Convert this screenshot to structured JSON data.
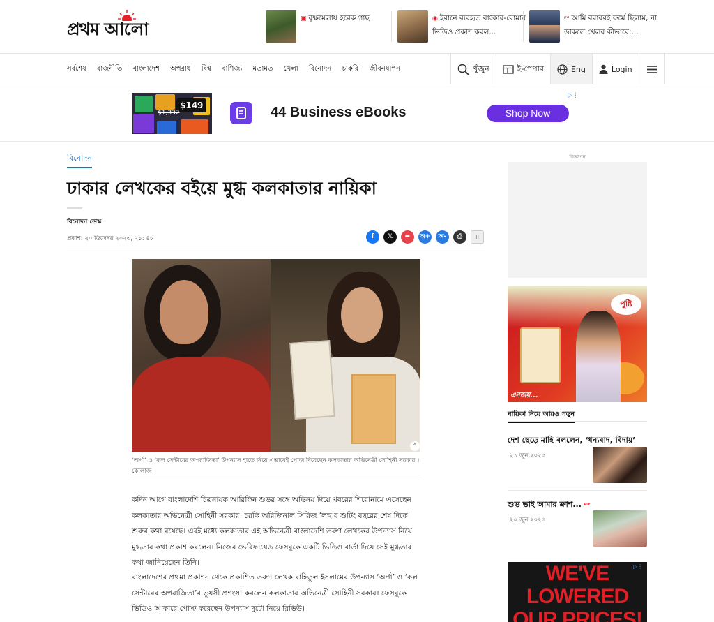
{
  "header": {
    "logo_text": "প্রথম আলো",
    "teasers": [
      {
        "title": "বৃক্ষমেলায় হরেক গাছ",
        "marker": "📷"
      },
      {
        "title": "ইরানে ব্যবহৃত বাংকার-বোমার ভিডিও প্রকাশ করল...",
        "marker": "◉"
      },
      {
        "title": "আমি বরাবরই ফর্মে ছিলাম, না ডাকলে খেলব কীভাবে:...",
        "marker": "ᵖᵃ"
      }
    ]
  },
  "nav": {
    "items": [
      "সর্বশেষ",
      "রাজনীতি",
      "বাংলাদেশ",
      "অপরাধ",
      "বিশ্ব",
      "বাণিজ্য",
      "মতামত",
      "খেলা",
      "বিনোদন",
      "চাকরি",
      "জীবনযাপন"
    ],
    "search_label": "খুঁজুন",
    "epaper_label": "ই-পেপার",
    "lang_label": "Eng",
    "login_label": "Login"
  },
  "ad_banner": {
    "price": "$149",
    "old_price": "$1,332",
    "title": "44 Business eBooks",
    "cta": "Shop Now"
  },
  "article": {
    "section": "বিনোদন",
    "headline": "ঢাকার লেখকের বইয়ে মুগ্ধ কলকাতার নায়িকা",
    "author": "বিনোদন ডেস্ক",
    "published": "প্রকাশ: ২০ ডিসেম্বর ২০২৩, ২১: ৪৮",
    "caption": "‘অর্পা’ ও ‘কল সেন্টারের অপরাজিতা’ উপন্যাস হাতে নিয়ে এভাবেই পোজ দিয়েছেন কলকাতার অভিনেত্রী সোহিনী সরকার । কোলাজ",
    "paragraphs": [
      "কদিন আগে বাংলাদেশি চিত্রনায়ক আরিফিন শুভর সঙ্গে অভিনয় দিয়ে খবরের শিরোনামে এসেছেন কলকাতার অভিনেত্রী সোহিনী সরকার। চরকি অরিজিনাল সিরিজ ‘লহু’র শুটিং বছরের শেষ দিকে শুরুর কথা রয়েছে। এরই মধ্যে কলকাতার এই অভিনেত্রী বাংলাদেশি তরুণ লেখকের উপন্যাস নিয়ে মুগ্ধতার কথা প্রকাশ করলেন। নিজের ভেরিফায়েড ফেসবুকে একটি ভিডিও বার্তা দিয়ে সেই মুগ্ধতার কথা জানিয়েছেন তিনি।",
      "বাংলাদেশের প্রথমা প্রকাশন থেকে প্রকাশিত তরুণ লেখক রাহিতুল ইসলামের উপন্যাস ‘অর্পা’ ও ‘কল সেন্টারের অপরাজিতা’র ভূয়সী প্রশংসা করলেন কলকাতার অভিনেত্রী সোহিনী সরকার। ফেসবুকে ভিডিও আকারে পোস্ট করেছেন উপন্যাস দুটো নিয়ে রিভিউ।"
    ]
  },
  "sidebar": {
    "ad_label": "বিজ্ঞাপন",
    "pusti_logo": "পুষ্টি",
    "pusti_brand": "এনজয়...",
    "more_title": "নায়িকা নিয়ে আরও পড়ুন",
    "related": [
      {
        "title": "দেশ ছেড়ে মাহি বললেন, ‘ধন্যবাদ, বিদায়’",
        "date": "২১ জুন ২০২৫"
      },
      {
        "title": "শুভ ভাই আমার ক্রাশ...",
        "date": "২০ জুন ২০২৫"
      }
    ],
    "bottom_ad_lines": [
      "WE'VE",
      "LOWERED",
      "OUR PRICES!"
    ]
  },
  "colors": {
    "accent": "#1570c8",
    "brand_red": "#e8222b",
    "cta_purple": "#6a2fe0"
  }
}
